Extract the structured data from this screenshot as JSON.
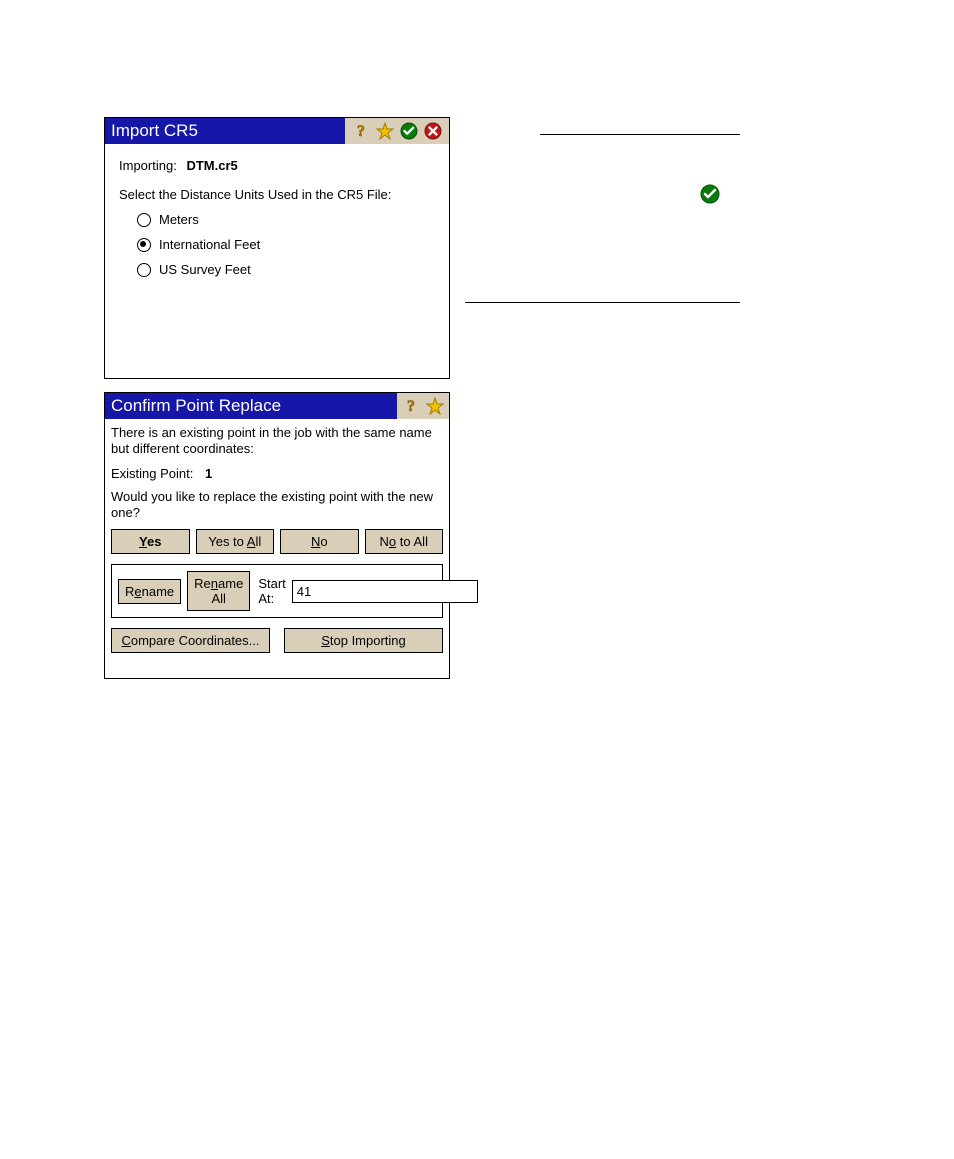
{
  "dialog_import": {
    "title": "Import CR5",
    "importing_label": "Importing:",
    "importing_value": "DTM.cr5",
    "units_prompt": "Select the Distance Units Used in the CR5 File:",
    "options": {
      "meters": "Meters",
      "intl_feet": "International Feet",
      "us_feet": "US Survey Feet"
    },
    "selected": "intl_feet"
  },
  "dialog_confirm": {
    "title": "Confirm Point Replace",
    "message1": "There is an existing point in the job with the same name but different coordinates:",
    "existing_label": "Existing Point:",
    "existing_value": "1",
    "message2": "Would you like to replace the existing point with the new one?",
    "buttons": {
      "yes": "Yes",
      "yes_all": "Yes to All",
      "no": "No",
      "no_all": "No to All",
      "rename": "Rename",
      "rename_all": "Rename All",
      "compare": "Compare Coordinates...",
      "stop": "Stop Importing"
    },
    "start_at_label": "Start At:",
    "start_at_value": "41"
  }
}
